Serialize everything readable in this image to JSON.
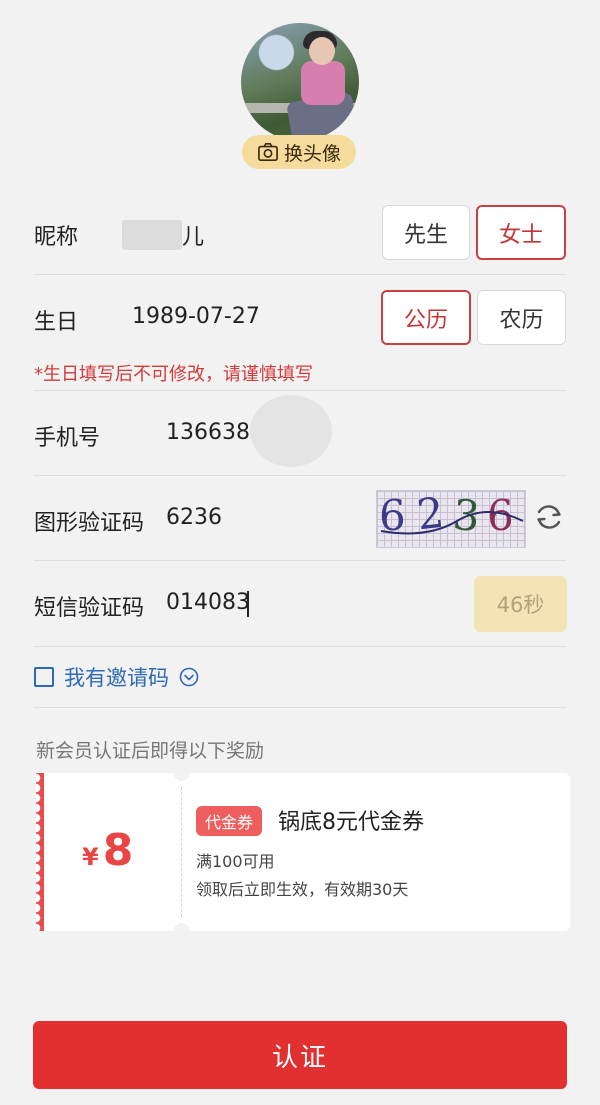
{
  "avatar": {
    "change_label": "换头像",
    "icon": "camera-icon"
  },
  "form": {
    "nickname": {
      "label": "昵称",
      "value": "儿",
      "options": [
        "先生",
        "女士"
      ],
      "selected": "女士"
    },
    "birthday": {
      "label": "生日",
      "value": "1989-07-27",
      "calendar_options": [
        "公历",
        "农历"
      ],
      "selected": "公历",
      "hint": "*生日填写后不可修改，请谨慎填写"
    },
    "phone": {
      "label": "手机号",
      "value": "136638"
    },
    "captcha": {
      "label": "图形验证码",
      "value": "6236",
      "image_text": [
        "6",
        "2",
        "3",
        "6"
      ],
      "refresh_icon": "refresh-icon"
    },
    "sms": {
      "label": "短信验证码",
      "value": "014083",
      "countdown": "46秒"
    },
    "invite": {
      "label": "我有邀请码",
      "icon": "chevron-down-circle-icon"
    }
  },
  "reward": {
    "title": "新会员认证后即得以下奖励",
    "coupon": {
      "currency": "¥",
      "amount": "8",
      "tag": "代金券",
      "name": "锅底8元代金券",
      "condition": "满100可用",
      "validity": "领取后立即生效，有效期30天"
    }
  },
  "submit_label": "认证",
  "colors": {
    "accent": "#e22f2f",
    "gold": "#f6dc9c",
    "link": "#2f6ab8"
  }
}
